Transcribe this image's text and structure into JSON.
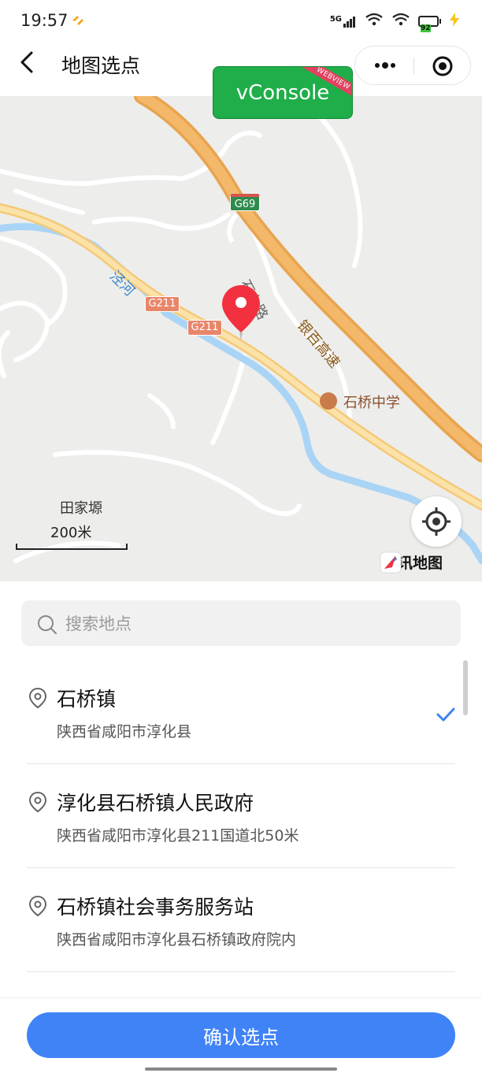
{
  "status_bar": {
    "time": "19:57",
    "network": "5G",
    "battery": "92"
  },
  "nav": {
    "title": "地图选点"
  },
  "vconsole": {
    "label": "vConsole",
    "ribbon": "WEBVIEW"
  },
  "map": {
    "labels": {
      "g69": "G69",
      "g211_a": "G211",
      "g211_b": "G211",
      "river": "泾河",
      "road": "石九路",
      "highway": "银百高速",
      "school": "石桥中学",
      "village": "田家塬"
    },
    "scale": "200米",
    "brand": "腾讯地图"
  },
  "search": {
    "placeholder": "搜索地点"
  },
  "places": [
    {
      "name": "石桥镇",
      "address": "陕西省咸阳市淳化县",
      "selected": true
    },
    {
      "name": "淳化县石桥镇人民政府",
      "address": "陕西省咸阳市淳化县211国道北50米",
      "selected": false
    },
    {
      "name": "石桥镇社会事务服务站",
      "address": "陕西省咸阳市淳化县石桥镇政府院内",
      "selected": false
    }
  ],
  "confirm": {
    "label": "确认选点"
  },
  "colors": {
    "accent": "#4083f7",
    "marker": "#f2303f",
    "vconsole": "#1fae49"
  }
}
